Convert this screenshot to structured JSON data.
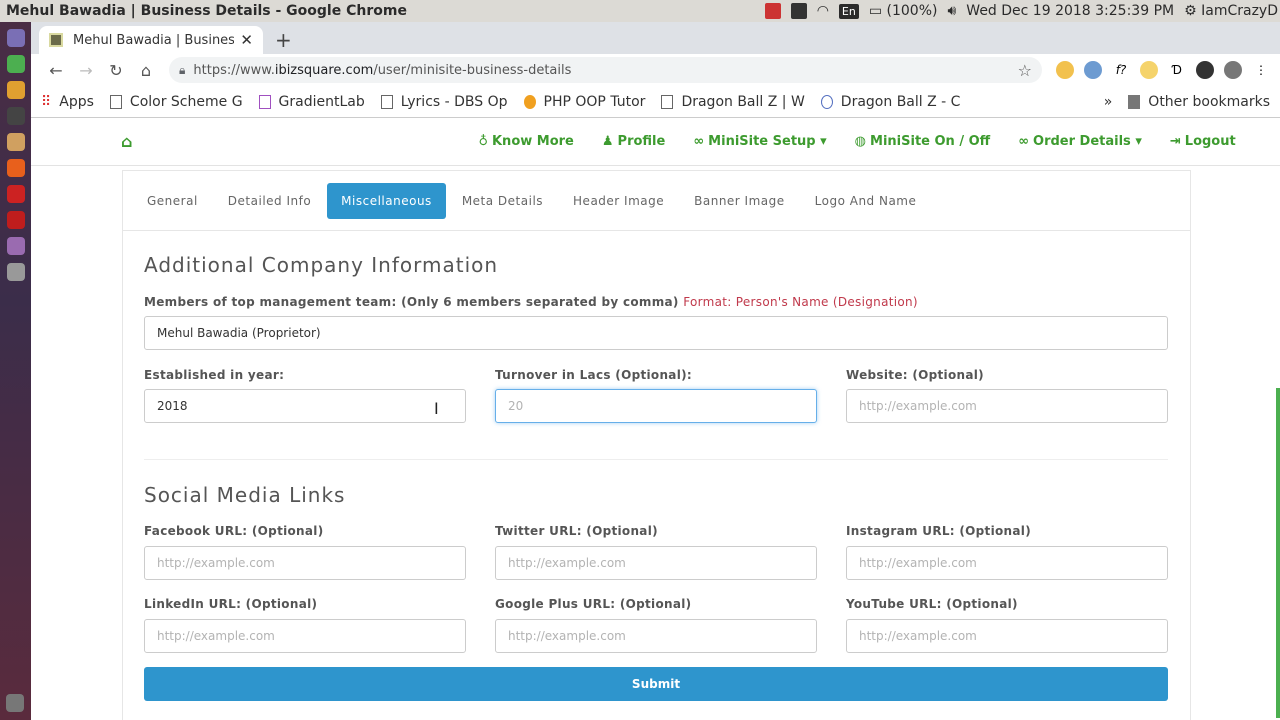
{
  "os": {
    "window_title": "Mehul Bawadia | Business Details - Google Chrome",
    "kbd": "En",
    "battery": "(100%)",
    "datetime": "Wed Dec 19 2018  3:25:39 PM",
    "user": "IamCrazyD"
  },
  "browser": {
    "tab_title": "Mehul Bawadia | Business",
    "url_scheme": "https://www.",
    "url_domain": "ibizsquare.com",
    "url_path": "/user/minisite-business-details",
    "bookmarks": [
      "Apps",
      "Color Scheme G",
      "GradientLab",
      "Lyrics - DBS Op",
      "PHP OOP Tutor",
      "Dragon Ball Z | W",
      "Dragon Ball Z - C"
    ],
    "other_bookmarks": "Other bookmarks"
  },
  "nav": {
    "items": [
      "Know More",
      "Profile",
      "MiniSite Setup",
      "MiniSite On / Off",
      "Order Details",
      "Logout"
    ]
  },
  "tabs": [
    "General",
    "Detailed Info",
    "Miscellaneous",
    "Meta Details",
    "Header Image",
    "Banner Image",
    "Logo And Name"
  ],
  "company": {
    "title": "Additional Company Information",
    "members_label": "Members of top management team: (Only 6 members separated by comma)",
    "members_hint": "Format: Person's Name (Designation)",
    "members_value": "Mehul Bawadia (Proprietor)",
    "established_label": "Established in year:",
    "established_value": "2018",
    "turnover_label": "Turnover in Lacs (Optional):",
    "turnover_placeholder": "20",
    "website_label": "Website: (Optional)",
    "website_placeholder": "http://example.com"
  },
  "social": {
    "title": "Social Media Links",
    "facebook_label": "Facebook URL: (Optional)",
    "twitter_label": "Twitter URL: (Optional)",
    "instagram_label": "Instagram URL: (Optional)",
    "linkedin_label": "LinkedIn URL: (Optional)",
    "googleplus_label": "Google Plus URL: (Optional)",
    "youtube_label": "YouTube URL: (Optional)",
    "placeholder": "http://example.com"
  },
  "submit_label": "Submit",
  "colors": {
    "nav_green": "#3d9b2f",
    "primary_blue": "#2e95cd",
    "hint_red": "#c0394b"
  }
}
